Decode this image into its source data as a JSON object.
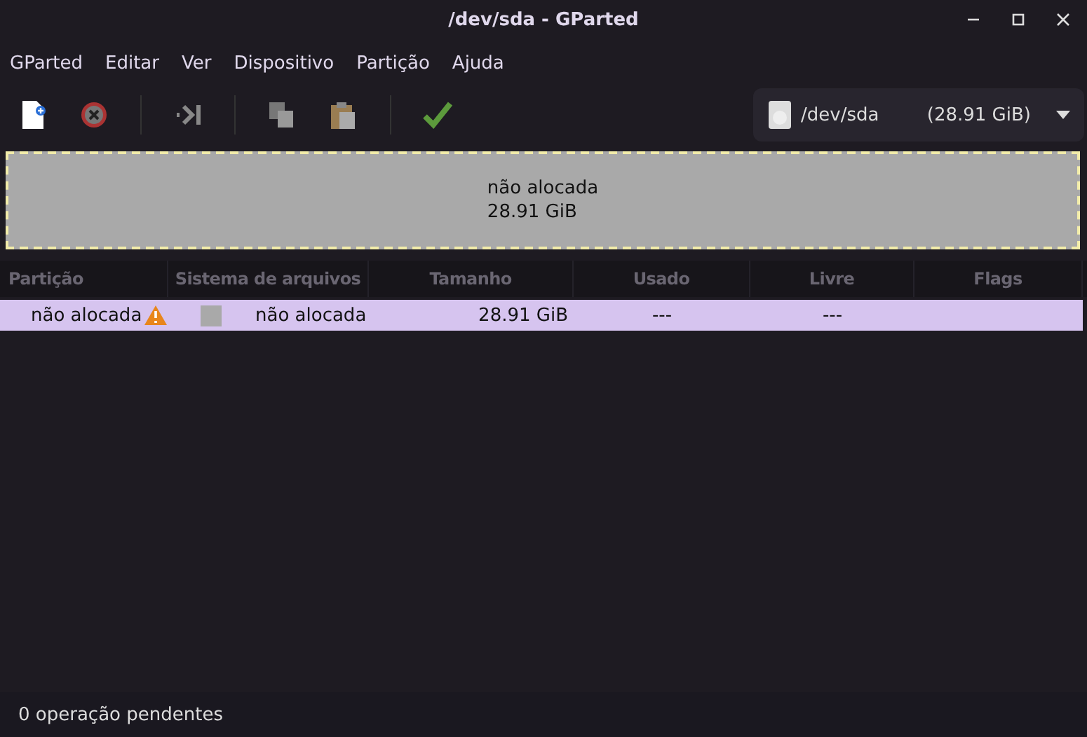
{
  "window": {
    "title": "/dev/sda - GParted"
  },
  "menu": [
    "GParted",
    "Editar",
    "Ver",
    "Dispositivo",
    "Partição",
    "Ajuda"
  ],
  "device": {
    "name": "/dev/sda",
    "size": "(28.91 GiB)"
  },
  "disk_map": [
    {
      "label": "não alocada",
      "size": "28.91 GiB",
      "selected": true
    }
  ],
  "table": {
    "columns": [
      "Partição",
      "Sistema de arquivos",
      "Tamanho",
      "Usado",
      "Livre",
      "Flags"
    ],
    "rows": [
      {
        "partition": "não alocada",
        "warning": true,
        "filesystem": "não alocada",
        "color": "#a9a9a9",
        "size": "28.91 GiB",
        "used": "---",
        "free": "---",
        "selected": true
      }
    ]
  },
  "status_bar": "0 operação pendentes"
}
